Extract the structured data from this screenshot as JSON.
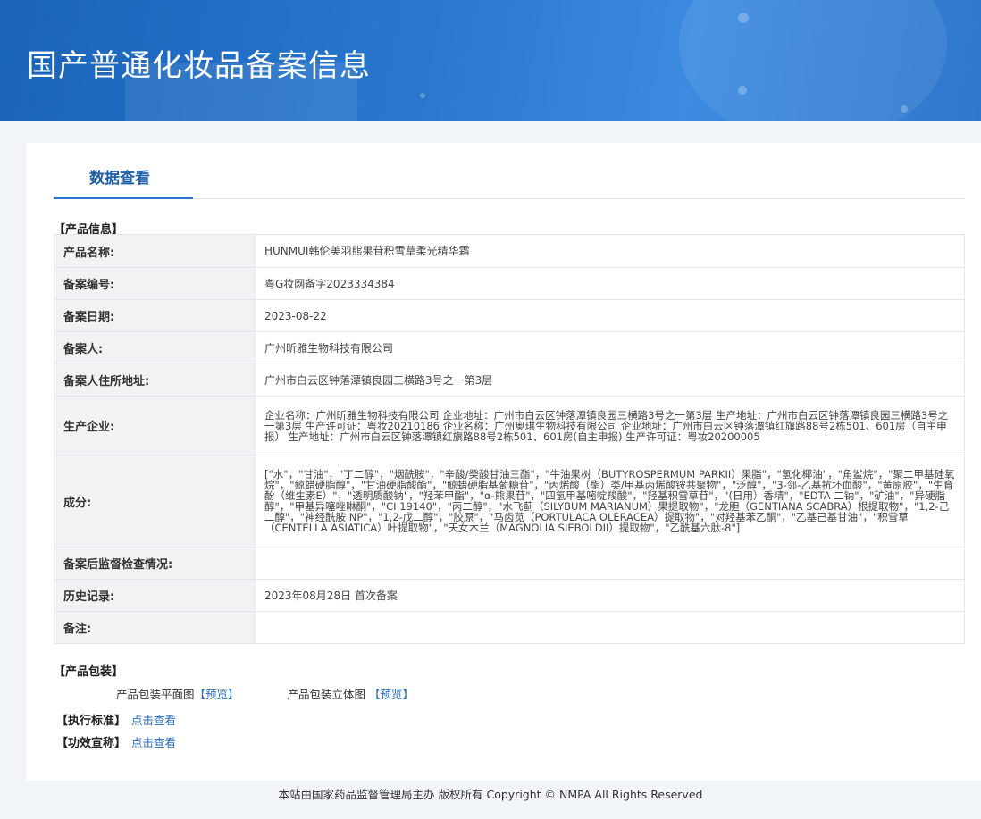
{
  "header": {
    "title": "国产普通化妆品备案信息"
  },
  "tabs": [
    {
      "label": "数据查看"
    }
  ],
  "product_info": {
    "section_label": "【产品信息】",
    "rows": [
      {
        "key": "产品名称:",
        "value": "HUNMUI韩伦美羽熊果苷积雪草柔光精华霜"
      },
      {
        "key": "备案编号:",
        "value": "粤G妆网备字2023334384"
      },
      {
        "key": "备案日期:",
        "value": "2023-08-22"
      },
      {
        "key": "备案人:",
        "value": "广州昕雅生物科技有限公司"
      },
      {
        "key": "备案人住所地址:",
        "value": "广州市白云区钟落潭镇良园三横路3号之一第3层"
      },
      {
        "key": "生产企业:",
        "value": "企业名称：广州昕雅生物科技有限公司 企业地址：广州市白云区钟落潭镇良园三横路3号之一第3层 生产地址：广州市白云区钟落潭镇良园三横路3号之一第3层 生产许可证：粤妆20210186 企业名称：广州奥琪生物科技有限公司 企业地址：广州市白云区钟落潭镇红旗路88号2栋501、601房（自主申报） 生产地址：广州市白云区钟落潭镇红旗路88号2栋501、601房(自主申报) 生产许可证：粤妆20200005"
      },
      {
        "key": "成分:",
        "value": "[\"水\"，\"甘油\"，\"丁二醇\"，\"烟酰胺\"，\"辛酸/癸酸甘油三酯\"，\"牛油果树（BUTYROSPERMUM PARKII）果脂\"，\"氢化椰油\"，\"角鲨烷\"，\"聚二甲基硅氧烷\"，\"鲸蜡硬脂醇\"，\"甘油硬脂酸酯\"，\"鲸蜡硬脂基葡糖苷\"，\"丙烯酸（酯）类/甲基丙烯酸铵共聚物\"，\"泛醇\"，\"3-邻-乙基抗坏血酸\"，\"黄原胶\"，\"生育酚（维生素E）\"，\"透明质酸钠\"，\"羟苯甲酯\"，\"α-熊果苷\"，\"四氢甲基嘧啶羧酸\"，\"羟基积雪草苷\"，\"(日用）香精\"，\"EDTA 二钠\"，\"矿油\"，\"异硬脂醇\"，\"甲基异噻唑啉酮\"，\"CI 19140\"，\"丙二醇\"，\"水飞蓟（SILYBUM MARIANUM）果提取物\"，\"龙胆（GENTIANA SCABRA）根提取物\"，\"1,2-己二醇\"，\"神经酰胺 NP\"，\"1,2-戊二醇\"，\"胶原\"，\"马齿苋（PORTULACA OLERACEA）提取物\"，\"对羟基苯乙酮\"，\"乙基己基甘油\"，\"积雪草（CENTELLA ASIATICA）叶提取物\"，\"天女木兰（MAGNOLIA SIEBOLDII）提取物\"，\"乙酰基六肽-8\"]"
      },
      {
        "key": "备案后监督检查情况:",
        "value": ""
      },
      {
        "key": "历史记录:",
        "value": "2023年08月28日 首次备案"
      },
      {
        "key": "备注:",
        "value": ""
      }
    ]
  },
  "packaging": {
    "section_label": "【产品包装】",
    "flat_label": "产品包装平面图",
    "flat_link": "【预览】",
    "stereo_label": "产品包装立体图",
    "stereo_link": "【预览】"
  },
  "standard": {
    "label": "【执行标准】",
    "link": "点击查看"
  },
  "efficacy": {
    "label": "【功效宣称】",
    "link": "点击查看"
  },
  "footer": {
    "text": "本站由国家药品监督管理局主办 版权所有 Copyright © NMPA All Rights Reserved"
  }
}
